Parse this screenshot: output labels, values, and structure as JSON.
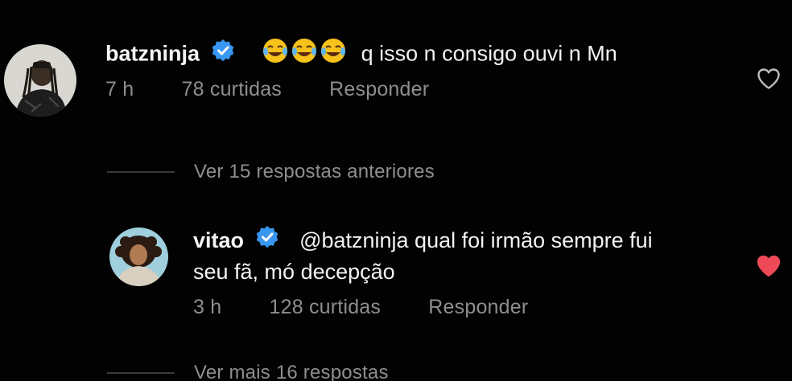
{
  "comment": {
    "username": "batzninja",
    "emojis": [
      "face-with-tears-of-joy-icon",
      "face-with-tears-of-joy-icon",
      "face-with-tears-of-joy-icon"
    ],
    "text": "q isso n consigo ouvi n Mn",
    "time": "7 h",
    "likes": "78 curtidas",
    "reply_label": "Responder",
    "liked": false
  },
  "previous_replies": {
    "label": "Ver 15 respostas anteriores"
  },
  "reply": {
    "username": "vitao",
    "text_line1": "@batzninja qual foi irmão sempre fui",
    "text_line2": "seu fã, mó decepção",
    "time": "3 h",
    "likes": "128 curtidas",
    "reply_label": "Responder",
    "liked": true
  },
  "more_replies": {
    "label": "Ver mais 16 respostas"
  },
  "colors": {
    "background": "#020202",
    "verified_blue": "#3897f0",
    "meta_gray": "#8e8e8e",
    "like_red": "#ed4956"
  }
}
